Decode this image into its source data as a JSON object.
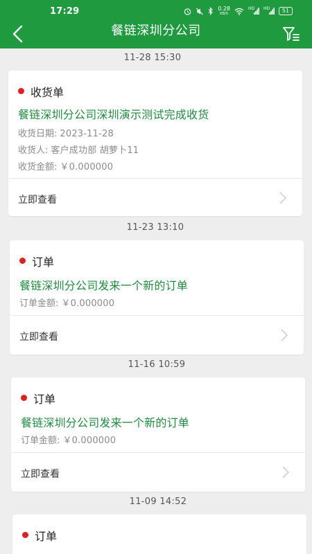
{
  "status_bar": {
    "time": "17:29",
    "net_speed_value": "0.28",
    "net_speed_unit": "KB/S",
    "signal1_label": "HD",
    "signal2_label": "HD",
    "battery": "51"
  },
  "header": {
    "title": "餐链深圳分公司",
    "back_icon": "chevron-left-icon",
    "filter_icon": "filter-list-icon"
  },
  "colors": {
    "header_bg": "#1f9a3f",
    "headline_green": "#1f8a3f",
    "dot_red": "#e02020"
  },
  "feed": [
    {
      "timestamp": "11-28 15:30",
      "card": {
        "type": "收货单",
        "headline": "餐链深圳分公司深圳演示测试完成收货",
        "details": [
          {
            "label": "收货日期:",
            "value": "2023-11-28"
          },
          {
            "label": "收货人:",
            "value": "客户成功部 胡萝卜11"
          },
          {
            "label": "收货金额:",
            "value": "￥0.000000"
          }
        ],
        "action": "立即查看"
      }
    },
    {
      "timestamp": "11-23 13:10",
      "card": {
        "type": "订单",
        "headline": "餐链深圳分公司发来一个新的订单",
        "details": [
          {
            "label": "订单金额:",
            "value": "￥0.000000"
          }
        ],
        "action": "立即查看"
      }
    },
    {
      "timestamp": "11-16 10:59",
      "card": {
        "type": "订单",
        "headline": "餐链深圳分公司发来一个新的订单",
        "details": [
          {
            "label": "订单金额:",
            "value": "￥0.000000"
          }
        ],
        "action": "立即查看"
      }
    },
    {
      "timestamp": "11-09 14:52",
      "card": {
        "type": "订单",
        "headline": "",
        "details": [],
        "action": ""
      }
    }
  ]
}
